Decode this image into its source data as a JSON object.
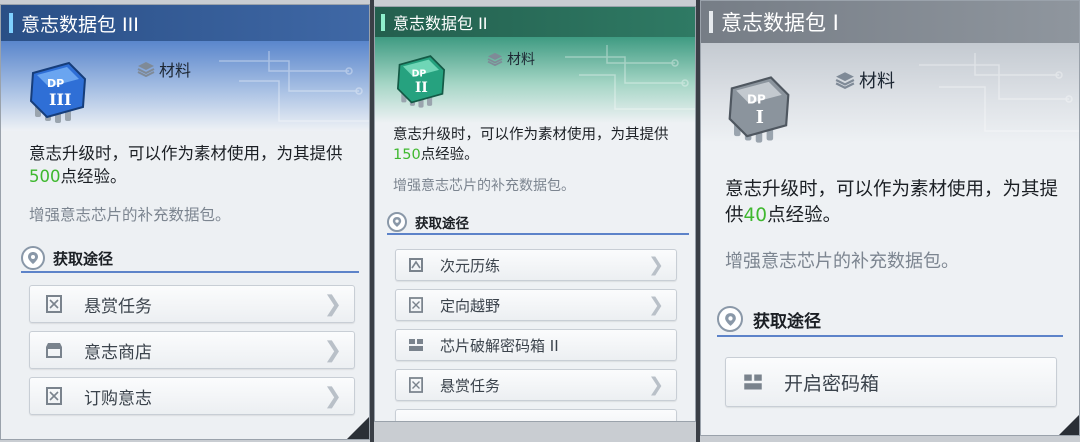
{
  "colors": {
    "accent_green": "#3fb82f",
    "header_blue": "#2a4f86",
    "header_teal": "#2a6b58",
    "header_gray": "#7d848c",
    "source_underline": "#5d83c9"
  },
  "cards": [
    {
      "title": "意志数据包 III",
      "category": "材料",
      "chip_label": "DP",
      "chip_roman": "III",
      "desc_before": "意志升级时，可以作为素材使用，为其提供",
      "desc_value": "500",
      "desc_after": "点经验。",
      "flavor": "增强意志芯片的补充数据包。",
      "source_title": "获取途径",
      "sources": [
        {
          "label": "悬赏任务",
          "icon": "bounty-icon"
        },
        {
          "label": "意志商店",
          "icon": "shop-icon"
        },
        {
          "label": "订购意志",
          "icon": "order-icon"
        }
      ]
    },
    {
      "title": "意志数据包 II",
      "category": "材料",
      "chip_label": "DP",
      "chip_roman": "II",
      "desc_before": "意志升级时，可以作为素材使用，为其提供",
      "desc_value": "150",
      "desc_after": "点经验。",
      "flavor": "增强意志芯片的补充数据包。",
      "source_title": "获取途径",
      "sources": [
        {
          "label": "次元历练",
          "icon": "dimension-icon"
        },
        {
          "label": "定向越野",
          "icon": "orienteering-icon"
        },
        {
          "label": "芯片破解密码箱 II",
          "icon": "cipher-box-icon"
        },
        {
          "label": "悬赏任务",
          "icon": "bounty-icon"
        }
      ]
    },
    {
      "title": "意志数据包 I",
      "category": "材料",
      "chip_label": "DP",
      "chip_roman": "I",
      "desc_before": "意志升级时，可以作为素材使用，为其提供",
      "desc_value": "40",
      "desc_after": "点经验。",
      "flavor": "增强意志芯片的补充数据包。",
      "source_title": "获取途径",
      "sources": [
        {
          "label": "开启密码箱",
          "icon": "cipher-box-icon"
        }
      ]
    }
  ]
}
